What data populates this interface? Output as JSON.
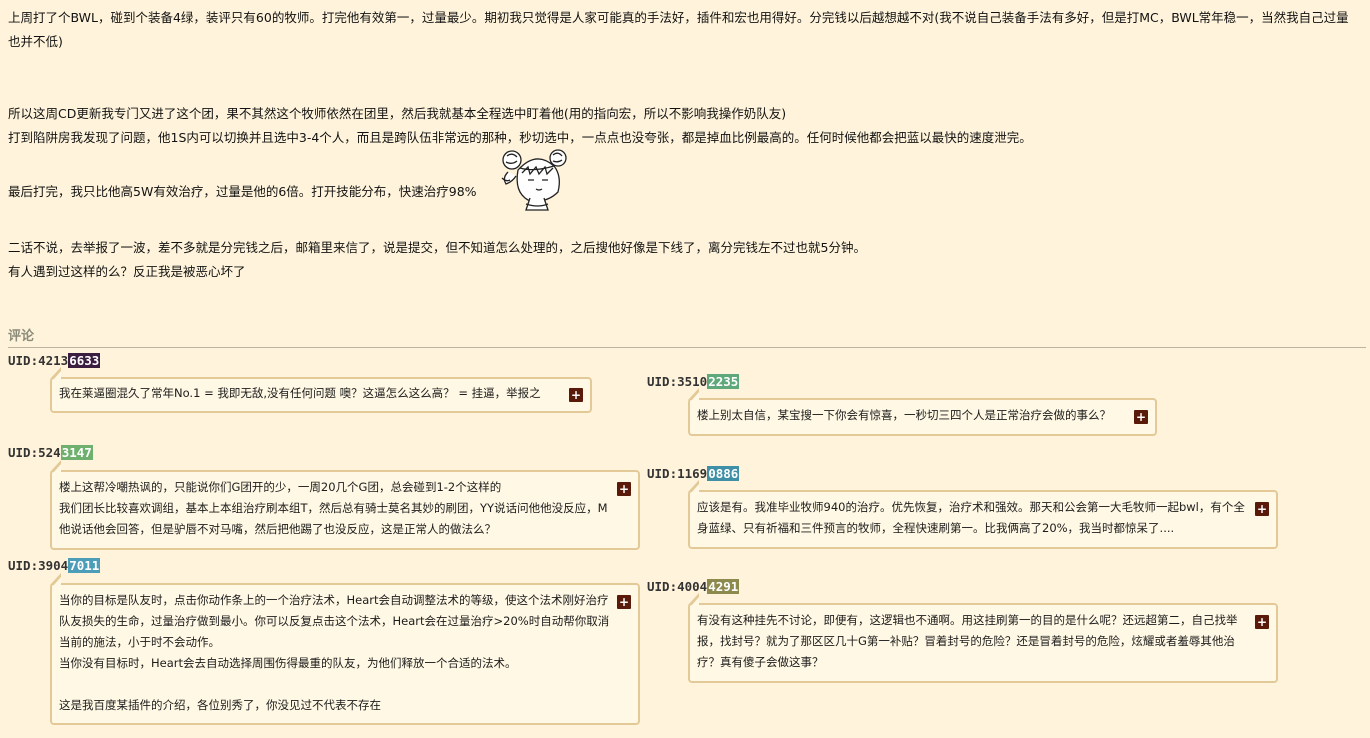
{
  "post": {
    "paragraphs": [
      "上周打了个BWL，碰到个装备4绿，装评只有60的牧师。打完他有效第一，过量最少。期初我只觉得是人家可能真的手法好，插件和宏也用得好。分完钱以后越想越不对(我不说自己装备手法有多好，但是打MC，BWL常年稳一，当然我自己过量也并不低)",
      "所以这周CD更新我专门又进了这个团，果不其然这个牧师依然在团里，然后我就基本全程选中盯着他(用的指向宏，所以不影响我操作奶队友)",
      "打到陷阱房我发现了问题，他1S内可以切换并且选中3-4个人，而且是跨队伍非常远的那种，秒切选中，一点点也没夸张，都是掉血比例最高的。任何时候他都会把蓝以最快的速度泄完。",
      "最后打完，我只比他高5W有效治疗，过量是他的6倍。打开技能分布，快速治疗98%",
      "二话不说，去举报了一波，差不多就是分完钱之后，邮箱里来信了，说是提交，但不知道怎么处理的，之后搜他好像是下线了，离分完钱左不过也就5分钟。",
      "有人遇到过这样的么？反正我是被恶心坏了"
    ]
  },
  "comments_label": "评论",
  "comments": [
    {
      "uid_prefix": "UID:4213",
      "uid_suffix": "6633",
      "uid_color": "#3c1e40",
      "lines": [
        "我在莱逼圈混久了常年No.1 = 我即无敌,没有任何问题 噢？这逼怎么这么高？ = 挂逼，举报之"
      ]
    },
    {
      "uid_prefix": "UID:3510",
      "uid_suffix": "2235",
      "uid_color": "#5fa87b",
      "lines": [
        "楼上别太自信，某宝搜一下你会有惊喜，一秒切三四个人是正常治疗会做的事么？"
      ]
    },
    {
      "uid_prefix": "UID:524",
      "uid_suffix": "3147",
      "uid_color": "#6fb06e",
      "lines": [
        "楼上这帮冷嘲热讽的，只能说你们G团开的少，一周20几个G团，总会碰到1-2个这样的",
        "我们团长比较喜欢调组，基本上本组治疗刷本组T，然后总有骑士莫名其妙的刷团，YY说话问他他没反应，M他说话他会回答，但是驴唇不对马嘴，然后把他踢了也没反应，这是正常人的做法么？"
      ]
    },
    {
      "uid_prefix": "UID:1169",
      "uid_suffix": "0886",
      "uid_color": "#3f8fa6",
      "lines": [
        "应该是有。我准毕业牧师940的治疗。优先恢复，治疗术和强效。那天和公会第一大毛牧师一起bwl，有个全身蓝绿、只有祈福和三件预言的牧师，全程快速刷第一。比我俩高了20%，我当时都惊呆了...."
      ]
    },
    {
      "uid_prefix": "UID:3904",
      "uid_suffix": "7011",
      "uid_color": "#4c9db8",
      "lines": [
        "当你的目标是队友时，点击你动作条上的一个治疗法术，Heart会自动调整法术的等级，使这个法术刚好治疗队友损失的生命，过量治疗做到最小。你可以反复点击这个法术，Heart会在过量治疗>20%时自动帮你取消当前的施法，小于时不会动作。",
        "当你没有目标时，Heart会去自动选择周围伤得最重的队友，为他们释放一个合适的法术。",
        "",
        "这是我百度某插件的介绍，各位别秀了，你没见过不代表不存在"
      ]
    },
    {
      "uid_prefix": "UID:4004",
      "uid_suffix": "4291",
      "uid_color": "#8c8a4c",
      "lines": [
        "有没有这种挂先不讨论，即便有，这逻辑也不通啊。用这挂刷第一的目的是什么呢？还远超第二，自己找举报，找封号？就为了那区区几十G第一补贴？冒着封号的危险？还是冒着封号的危险，炫耀或者羞辱其他治疗？真有傻子会做这事？"
      ]
    }
  ],
  "expand_symbol": "+"
}
